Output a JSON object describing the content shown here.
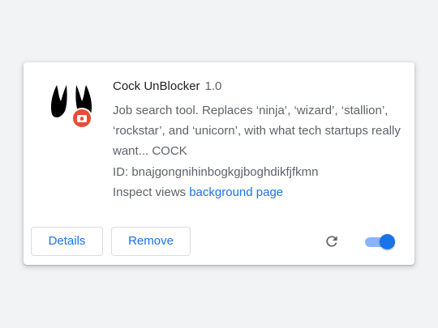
{
  "extension": {
    "name": "Cock UnBlocker",
    "version": "1.0",
    "description": "Job search tool. Replaces ‘ninja’, ‘wizard’, ‘stallion’, ‘rockstar’, and ‘unicorn’, with what tech startups really want... COCK",
    "id_label": "ID:",
    "id_value": "bnajgongnihinbogkgjboghdikfjfkmn",
    "inspect_label": "Inspect views",
    "inspect_link": "background page",
    "enabled": true
  },
  "buttons": {
    "details_label": "Details",
    "remove_label": "Remove"
  },
  "icons": {
    "extension_icon": "rooster-feet-icon",
    "badge_icon": "camera-badge-icon",
    "reload_icon": "reload-icon"
  },
  "colors": {
    "accent": "#1a73e8",
    "toggle_track": "#8ab4f8",
    "badge": "#e94b35",
    "background": "#f1f3f4"
  }
}
